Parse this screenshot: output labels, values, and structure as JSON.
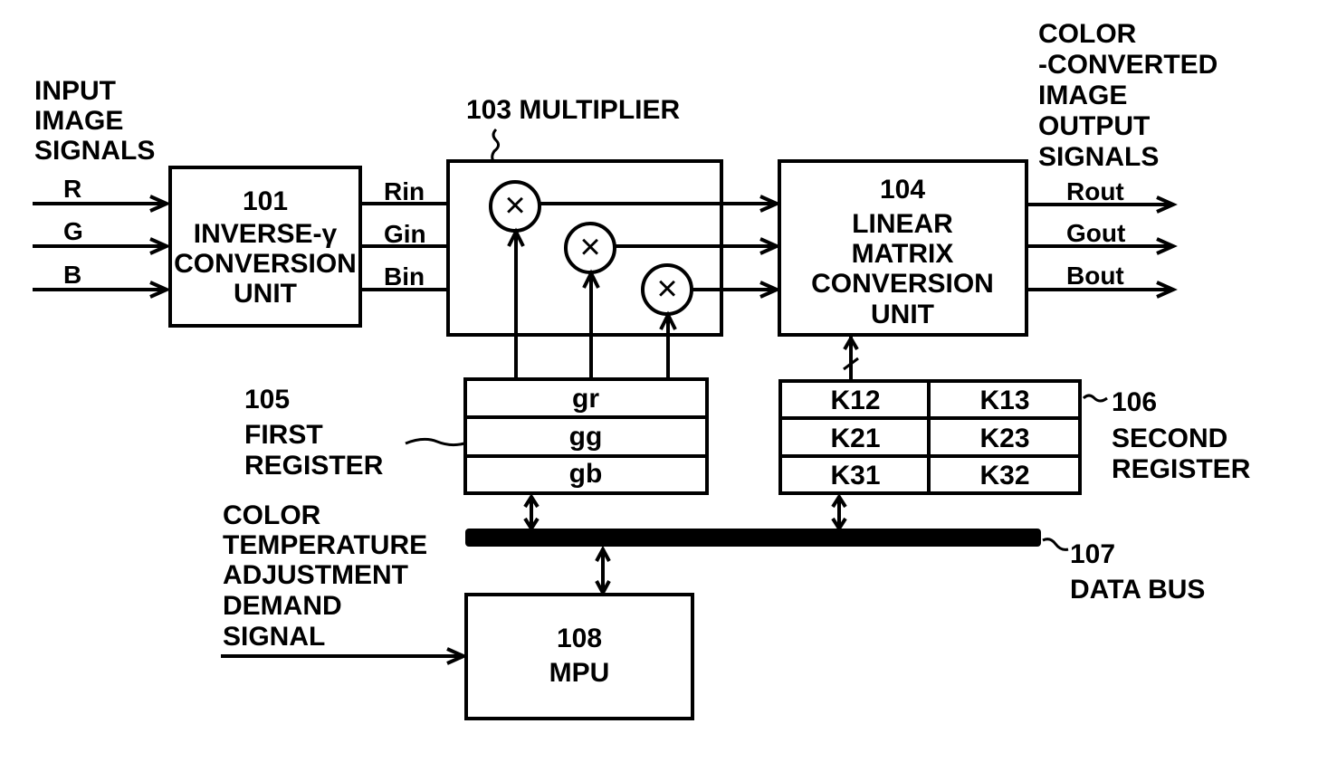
{
  "diagram": {
    "input_label": [
      "INPUT",
      "IMAGE",
      "SIGNALS"
    ],
    "inputs": [
      "R",
      "G",
      "B"
    ],
    "unit_101": {
      "number": "101",
      "lines": [
        "INVERSE-γ",
        "CONVERSION",
        "UNIT"
      ]
    },
    "intermediate_signals": [
      "Rin",
      "Gin",
      "Bin"
    ],
    "multiplier_103": {
      "label": "103 MULTIPLIER",
      "operator_symbol": "×"
    },
    "unit_104": {
      "number": "104",
      "lines": [
        "LINEAR",
        "MATRIX",
        "CONVERSION",
        "UNIT"
      ]
    },
    "output_label": [
      "COLOR",
      "-CONVERTED",
      "IMAGE",
      "OUTPUT",
      "SIGNALS"
    ],
    "outputs": [
      "Rout",
      "Gout",
      "Bout"
    ],
    "register_105": {
      "number": "105",
      "name_lines": [
        "FIRST",
        "REGISTER"
      ],
      "cells": [
        "gr",
        "gg",
        "gb"
      ]
    },
    "register_106": {
      "number": "106",
      "name_lines": [
        "SECOND",
        "REGISTER"
      ],
      "cells": [
        [
          "K12",
          "K13"
        ],
        [
          "K21",
          "K23"
        ],
        [
          "K31",
          "K32"
        ]
      ]
    },
    "data_bus_107": {
      "number": "107",
      "name": "DATA BUS"
    },
    "mpu_108": {
      "number": "108",
      "name": "MPU"
    },
    "demand_label": [
      "COLOR",
      "TEMPERATURE",
      "ADJUSTMENT",
      "DEMAND",
      "SIGNAL"
    ]
  }
}
